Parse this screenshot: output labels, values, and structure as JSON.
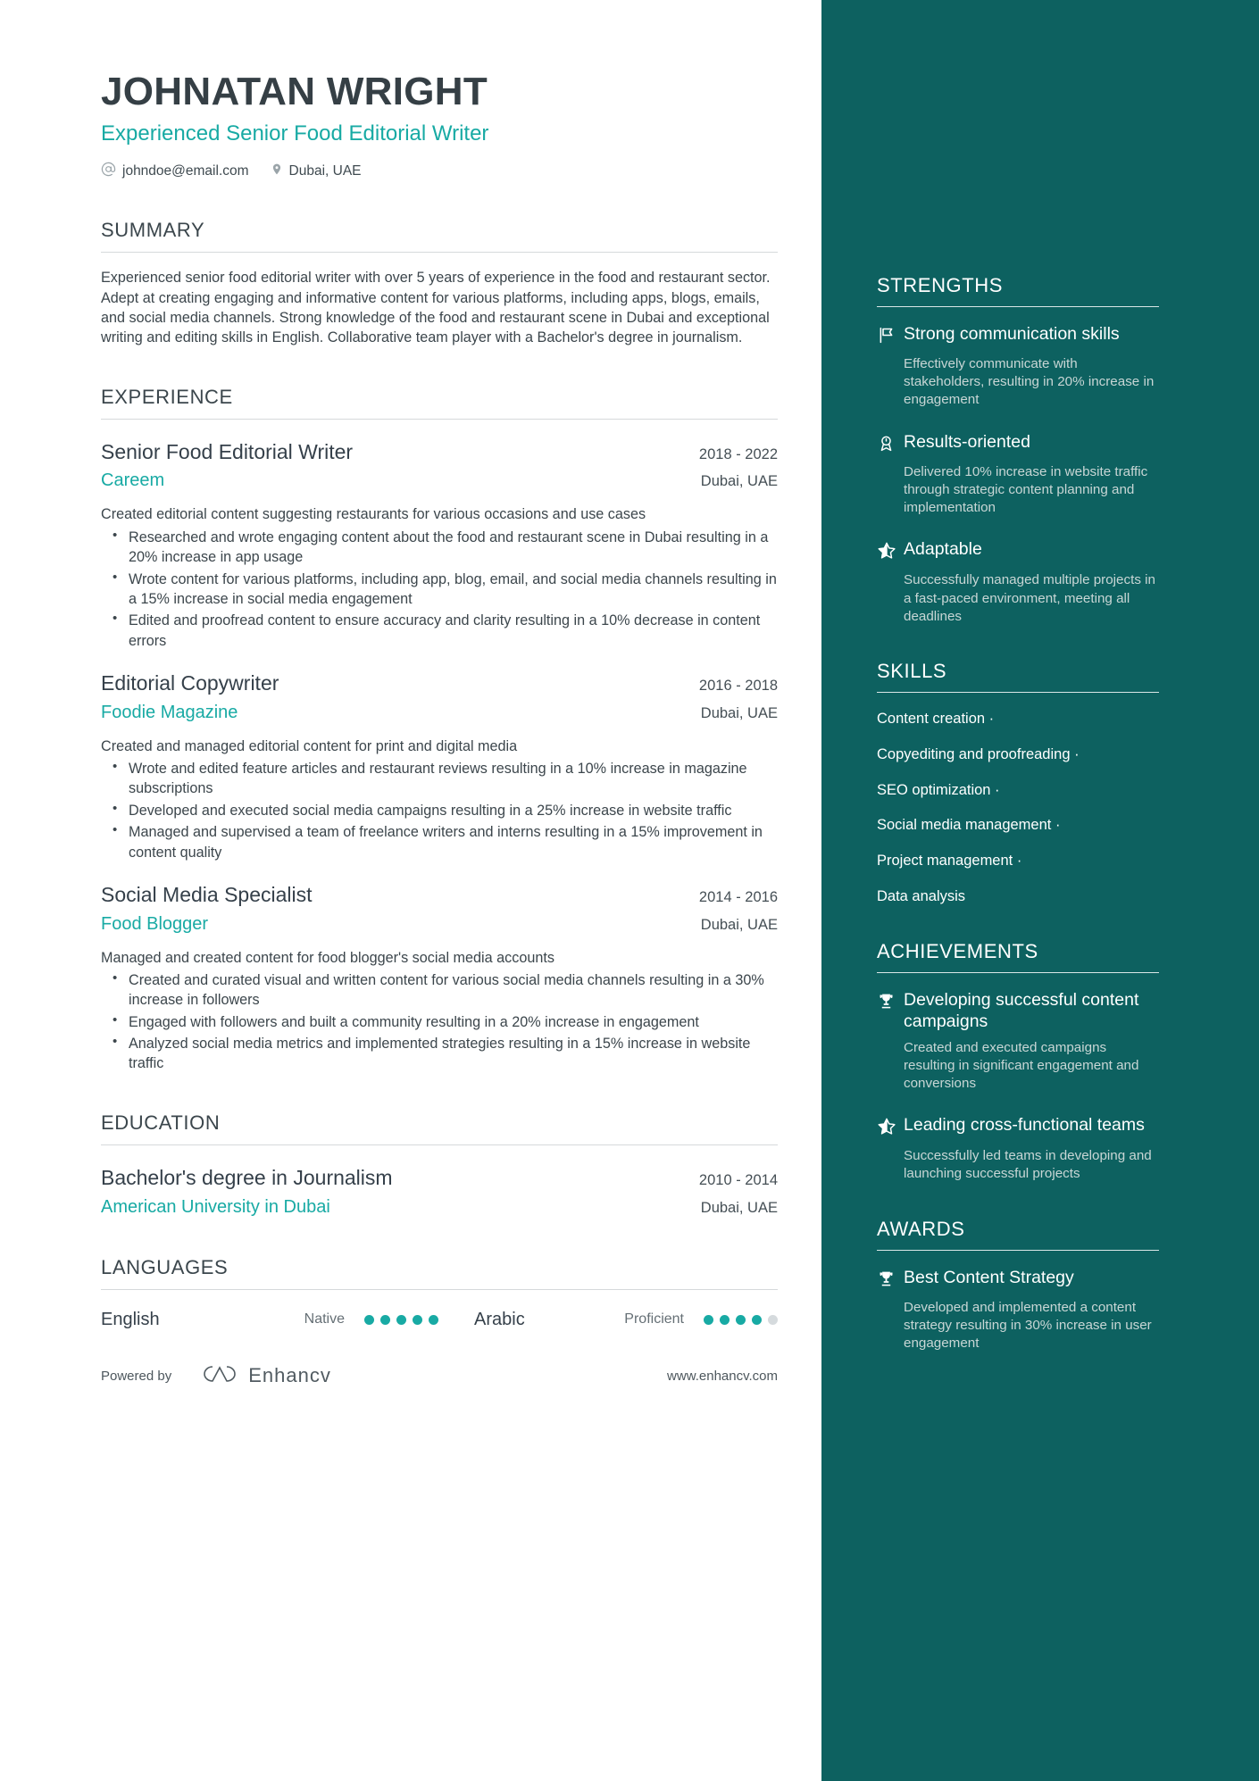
{
  "theme": {
    "accent": "#18aaa4",
    "sidebar_bg": "#0d6160",
    "heading": "#353f45",
    "body_text": "#3c464c",
    "muted_sidebar": "#c8d6d5"
  },
  "header": {
    "name": "JOHNATAN WRIGHT",
    "headline": "Experienced Senior Food Editorial Writer",
    "contacts": [
      {
        "icon": "at-icon",
        "text": "johndoe@email.com"
      },
      {
        "icon": "location-pin-icon",
        "text": "Dubai, UAE"
      }
    ]
  },
  "summary": {
    "title": "SUMMARY",
    "text": "Experienced senior food editorial writer with over 5 years of experience in the food and restaurant sector. Adept at creating engaging and informative content for various platforms, including apps, blogs, emails, and social media channels. Strong knowledge of the food and restaurant scene in Dubai and exceptional writing and editing skills in English. Collaborative team player with a Bachelor's degree in journalism."
  },
  "experience": {
    "title": "EXPERIENCE",
    "entries": [
      {
        "role": "Senior Food Editorial Writer",
        "company": "Careem",
        "dates": "2018 - 2022",
        "location": "Dubai, UAE",
        "description": "Created editorial content suggesting restaurants for various occasions and use cases",
        "bullets": [
          "Researched and wrote engaging content about the food and restaurant scene in Dubai resulting in a 20% increase in app usage",
          "Wrote content for various platforms, including app, blog, email, and social media channels resulting in a 15% increase in social media engagement",
          "Edited and proofread content to ensure accuracy and clarity resulting in a 10% decrease in content errors"
        ]
      },
      {
        "role": "Editorial Copywriter",
        "company": "Foodie Magazine",
        "dates": "2016 - 2018",
        "location": "Dubai, UAE",
        "description": "Created and managed editorial content for print and digital media",
        "bullets": [
          "Wrote and edited feature articles and restaurant reviews resulting in a 10% increase in magazine subscriptions",
          "Developed and executed social media campaigns resulting in a 25% increase in website traffic",
          "Managed and supervised a team of freelance writers and interns resulting in a 15% improvement in content quality"
        ]
      },
      {
        "role": "Social Media Specialist",
        "company": "Food Blogger",
        "dates": "2014 - 2016",
        "location": "Dubai, UAE",
        "description": "Managed and created content for food blogger's social media accounts",
        "bullets": [
          "Created and curated visual and written content for various social media channels resulting in a 30% increase in followers",
          "Engaged with followers and built a community resulting in a 20% increase in engagement",
          "Analyzed social media metrics and implemented strategies resulting in a 15% increase in website traffic"
        ]
      }
    ]
  },
  "education": {
    "title": "EDUCATION",
    "entries": [
      {
        "degree": "Bachelor's degree in Journalism",
        "school": "American University in Dubai",
        "dates": "2010 - 2014",
        "location": "Dubai, UAE"
      }
    ]
  },
  "languages": {
    "title": "LANGUAGES",
    "items": [
      {
        "name": "English",
        "level": "Native",
        "dots_filled": 5,
        "dots_total": 5
      },
      {
        "name": "Arabic",
        "level": "Proficient",
        "dots_filled": 4,
        "dots_total": 5
      }
    ]
  },
  "footer": {
    "powered_by": "Powered by",
    "brand": "Enhancv",
    "website": "www.enhancv.com"
  },
  "strengths": {
    "title": "STRENGTHS",
    "items": [
      {
        "icon": "flag-icon",
        "title": "Strong communication skills",
        "desc": "Effectively communicate with stakeholders, resulting in 20% increase in engagement"
      },
      {
        "icon": "award-medal-icon",
        "title": "Results-oriented",
        "desc": "Delivered 10% increase in website traffic through strategic content planning and implementation"
      },
      {
        "icon": "star-icon",
        "title": "Adaptable",
        "desc": "Successfully managed multiple projects in a fast-paced environment, meeting all deadlines"
      }
    ]
  },
  "skills": {
    "title": "SKILLS",
    "items": [
      "Content creation ·",
      "Copyediting and proofreading ·",
      "SEO optimization ·",
      "Social media management ·",
      "Project management ·",
      "Data analysis"
    ]
  },
  "achievements": {
    "title": "ACHIEVEMENTS",
    "items": [
      {
        "icon": "trophy-icon",
        "title": "Developing successful content campaigns",
        "desc": "Created and executed campaigns resulting in significant engagement and conversions"
      },
      {
        "icon": "star-icon",
        "title": "Leading cross-functional teams",
        "desc": "Successfully led teams in developing and launching successful projects"
      }
    ]
  },
  "awards": {
    "title": "AWARDS",
    "items": [
      {
        "icon": "trophy-icon",
        "title": "Best Content Strategy",
        "desc": "Developed and implemented a content strategy resulting in 30% increase in user engagement"
      }
    ]
  }
}
